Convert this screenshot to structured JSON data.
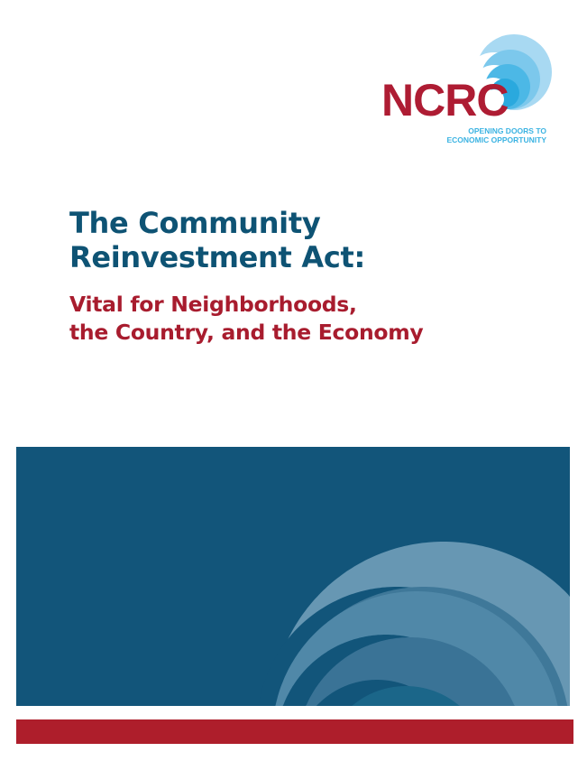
{
  "logo": {
    "name": "NCRC",
    "tagline_line1": "OPENING DOORS TO",
    "tagline_line2": "ECONOMIC OPPORTUNITY",
    "colors": {
      "wordmark": "#ae1c33",
      "tagline": "#3bb3e2"
    }
  },
  "title": {
    "line1": "The Community",
    "line2": "Reinvestment Act:"
  },
  "subtitle": {
    "line1": "Vital for Neighborhoods,",
    "line2": "the Country, and the Economy"
  },
  "colors": {
    "title": "#0e5374",
    "subtitle": "#a81c2e",
    "panel": "#12557a",
    "bar": "#ae1e2b"
  }
}
